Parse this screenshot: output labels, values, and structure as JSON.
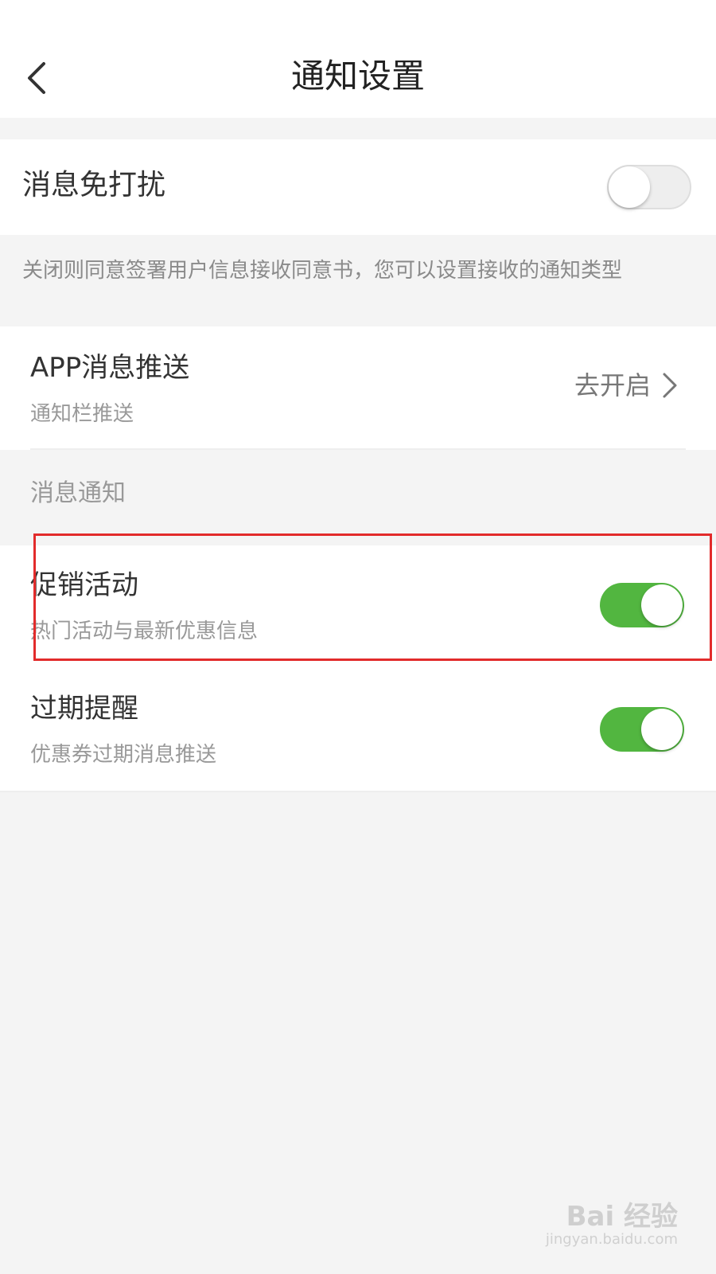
{
  "header": {
    "title": "通知设置",
    "back_icon": "chevron-left-icon"
  },
  "dnd": {
    "label": "消息免打扰",
    "enabled": false
  },
  "dnd_description": "关闭则同意签署用户信息接收同意书，您可以设置接收的通知类型",
  "app_push": {
    "title": "APP消息推送",
    "subtitle": "通知栏推送",
    "action_label": "去开启",
    "action_icon": "chevron-right-icon"
  },
  "message_section": {
    "label": "消息通知",
    "items": [
      {
        "title": "促销活动",
        "subtitle": "热门活动与最新优惠信息",
        "enabled": true
      },
      {
        "title": "过期提醒",
        "subtitle": "优惠券过期消息推送",
        "enabled": true
      }
    ]
  },
  "colors": {
    "toggle_on": "#52b640",
    "highlight": "#e22b2b"
  },
  "watermark": {
    "brand": "Bai 经验",
    "url": "jingyan.baidu.com"
  }
}
